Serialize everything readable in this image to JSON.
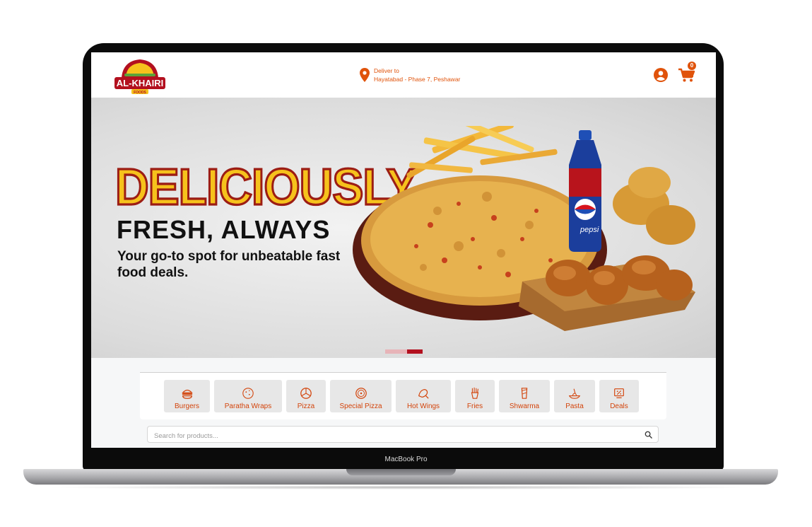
{
  "device": {
    "label": "MacBook Pro"
  },
  "header": {
    "logo_text": "AL-KHAIRI",
    "logo_subtext": "FOODS",
    "deliver_label": "Deliver to",
    "deliver_location": "Hayatabad - Phase 7, Peshawar",
    "cart_count": "0"
  },
  "hero": {
    "headline": "DELICIOUSLY",
    "subheadline": "FRESH, ALWAYS",
    "tagline": "Your go-to spot for unbeatable fast food deals.",
    "bottle_label": "pepsi",
    "slides_total": 2,
    "active_slide": 2
  },
  "categories": [
    {
      "label": "Burgers",
      "icon": "burger-icon"
    },
    {
      "label": "Paratha Wraps",
      "icon": "paratha-icon"
    },
    {
      "label": "Pizza",
      "icon": "pizza-icon"
    },
    {
      "label": "Special Pizza",
      "icon": "special-pizza-icon"
    },
    {
      "label": "Hot Wings",
      "icon": "wings-icon"
    },
    {
      "label": "Fries",
      "icon": "fries-icon"
    },
    {
      "label": "Shwarma",
      "icon": "shwarma-icon"
    },
    {
      "label": "Pasta",
      "icon": "pasta-icon"
    },
    {
      "label": "Deals",
      "icon": "deals-icon"
    }
  ],
  "search": {
    "placeholder": "Search for products..."
  },
  "colors": {
    "accent": "#e0530b",
    "brand_red": "#b3101f",
    "headline_yellow": "#f6c21c"
  }
}
